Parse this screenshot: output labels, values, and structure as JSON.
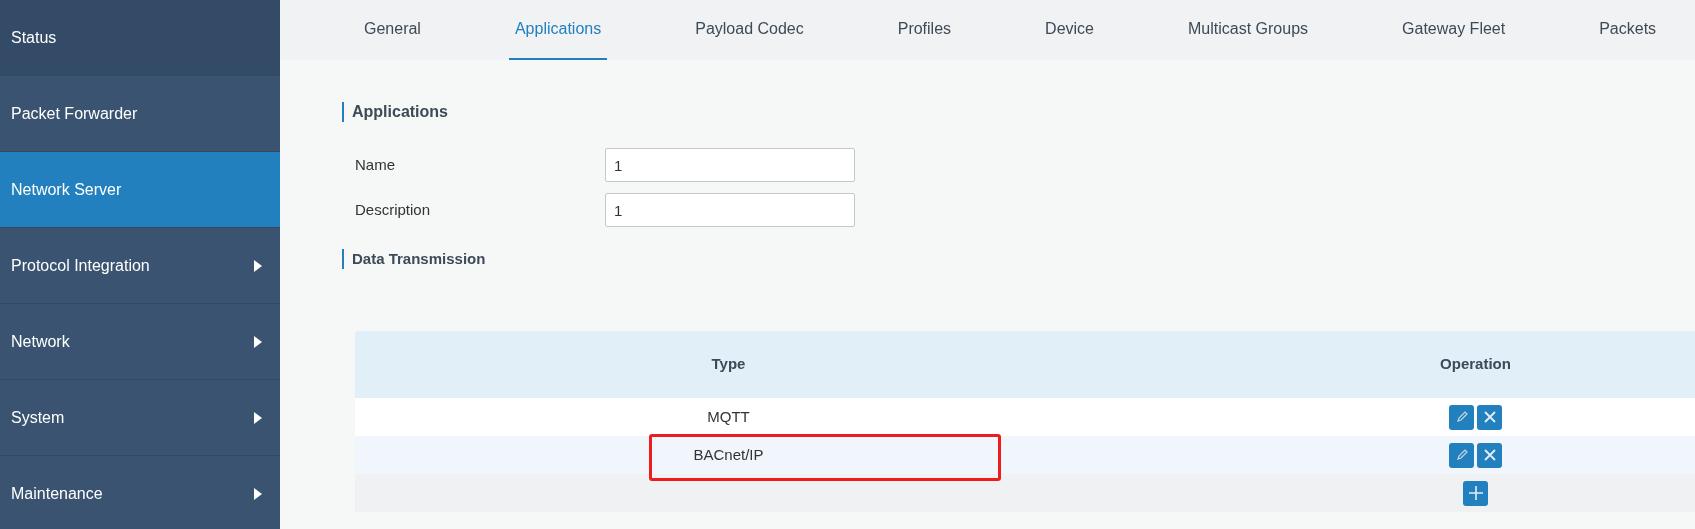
{
  "sidebar": {
    "items": [
      {
        "label": "Status",
        "selected": false,
        "has_submenu": false
      },
      {
        "label": "Packet Forwarder",
        "selected": false,
        "has_submenu": false
      },
      {
        "label": "Network Server",
        "selected": true,
        "has_submenu": false
      },
      {
        "label": "Protocol Integration",
        "selected": false,
        "has_submenu": true
      },
      {
        "label": "Network",
        "selected": false,
        "has_submenu": true
      },
      {
        "label": "System",
        "selected": false,
        "has_submenu": true
      },
      {
        "label": "Maintenance",
        "selected": false,
        "has_submenu": true
      }
    ]
  },
  "tabs": [
    {
      "label": "General",
      "selected": false
    },
    {
      "label": "Applications",
      "selected": true
    },
    {
      "label": "Payload Codec",
      "selected": false
    },
    {
      "label": "Profiles",
      "selected": false
    },
    {
      "label": "Device",
      "selected": false
    },
    {
      "label": "Multicast Groups",
      "selected": false
    },
    {
      "label": "Gateway Fleet",
      "selected": false
    },
    {
      "label": "Packets",
      "selected": false
    }
  ],
  "section_title": "Applications",
  "fields": [
    {
      "label": "Name",
      "value": "1"
    },
    {
      "label": "Description",
      "value": "1"
    }
  ],
  "data_transmission": {
    "title": "Data Transmission",
    "table": {
      "columns": [
        "Type",
        "Operation"
      ],
      "rows": [
        {
          "type": "MQTT",
          "highlighted": false
        },
        {
          "type": "BACnet/IP",
          "highlighted": true
        }
      ]
    }
  }
}
